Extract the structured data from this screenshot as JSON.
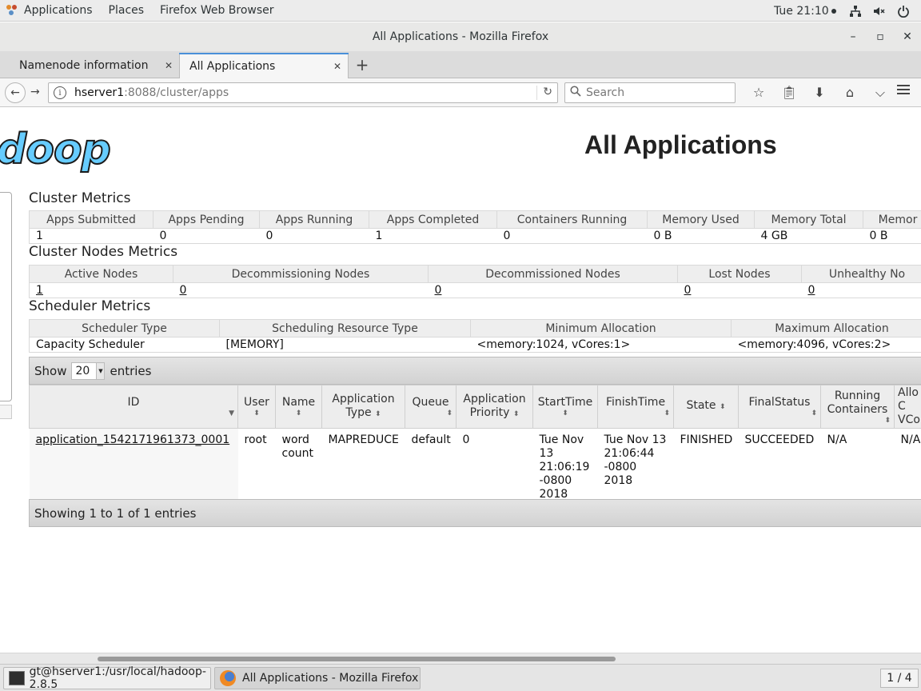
{
  "topbar": {
    "applications": "Applications",
    "places": "Places",
    "active_app": "Firefox Web Browser",
    "clock": "Tue 21:10"
  },
  "window": {
    "title": "All Applications - Mozilla Firefox"
  },
  "tabs": [
    {
      "label": "Namenode information"
    },
    {
      "label": "All Applications"
    }
  ],
  "urlbar": {
    "host": "hserver1",
    "path": ":8088/cluster/apps",
    "search_placeholder": "Search"
  },
  "page": {
    "logo_text": "doop",
    "title": "All Applications"
  },
  "cluster_metrics": {
    "title": "Cluster Metrics",
    "headers": [
      "Apps Submitted",
      "Apps Pending",
      "Apps Running",
      "Apps Completed",
      "Containers Running",
      "Memory Used",
      "Memory Total",
      "Memor"
    ],
    "values": [
      "1",
      "0",
      "0",
      "1",
      "0",
      "0 B",
      "4 GB",
      "0 B"
    ]
  },
  "node_metrics": {
    "title": "Cluster Nodes Metrics",
    "headers": [
      "Active Nodes",
      "Decommissioning Nodes",
      "Decommissioned Nodes",
      "Lost Nodes",
      "Unhealthy No"
    ],
    "values": [
      "1",
      "0",
      "0",
      "0",
      "0"
    ]
  },
  "scheduler_metrics": {
    "title": "Scheduler Metrics",
    "headers": [
      "Scheduler Type",
      "Scheduling Resource Type",
      "Minimum Allocation",
      "Maximum Allocation"
    ],
    "values": [
      "Capacity Scheduler",
      "[MEMORY]",
      "<memory:1024, vCores:1>",
      "<memory:4096, vCores:2>"
    ]
  },
  "datatable": {
    "show_label": "Show",
    "page_size": "20",
    "entries_label": "entries",
    "footer": "Showing 1 to 1 of 1 entries",
    "columns": [
      {
        "line1": "ID",
        "line2": ""
      },
      {
        "line1": "User",
        "line2": ""
      },
      {
        "line1": "Name",
        "line2": ""
      },
      {
        "line1": "Application",
        "line2": "Type"
      },
      {
        "line1": "Queue",
        "line2": ""
      },
      {
        "line1": "Application",
        "line2": "Priority"
      },
      {
        "line1": "StartTime",
        "line2": ""
      },
      {
        "line1": "FinishTime",
        "line2": ""
      },
      {
        "line1": "State",
        "line2": ""
      },
      {
        "line1": "FinalStatus",
        "line2": ""
      },
      {
        "line1": "Running",
        "line2": "Containers"
      },
      {
        "line1": "Allo",
        "line2": "C"
      }
    ],
    "col_extra_line3": "VCo",
    "row": {
      "id": "application_1542171961373_0001",
      "user": "root",
      "name": "word count",
      "type": "MAPREDUCE",
      "queue": "default",
      "priority": "0",
      "start": "Tue Nov 13 21:06:19 -0800 2018",
      "finish": "Tue Nov 13 21:06:44 -0800 2018",
      "state": "FINISHED",
      "final_status": "SUCCEEDED",
      "running_containers": "N/A",
      "allocated": "N/A"
    }
  },
  "taskbar": {
    "terminal": "gt@hserver1:/usr/local/hadoop-2.8.5",
    "firefox": "All Applications - Mozilla Firefox",
    "workspace": "1 / 4"
  },
  "icons": {
    "apps": "gnome-foot-icon",
    "network": "network-icon",
    "volume": "volume-icon",
    "power": "power-icon"
  }
}
